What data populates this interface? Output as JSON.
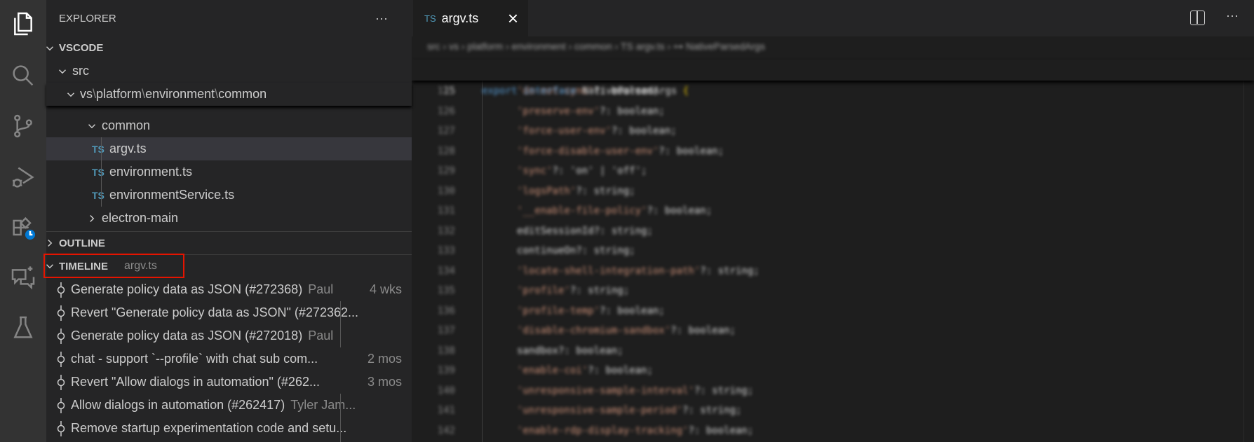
{
  "activity_bar": {
    "items": [
      {
        "name": "explorer",
        "icon": "files-icon"
      },
      {
        "name": "search",
        "icon": "search-icon"
      },
      {
        "name": "source-control",
        "icon": "source-control-icon"
      },
      {
        "name": "run-debug",
        "icon": "run-debug-icon"
      },
      {
        "name": "extensions",
        "icon": "extensions-icon",
        "badge": "clock-icon"
      },
      {
        "name": "chat",
        "icon": "chat-sparkle-icon"
      },
      {
        "name": "testing",
        "icon": "beaker-icon"
      }
    ]
  },
  "sidebar": {
    "title": "EXPLORER",
    "more": "···",
    "root": "VSCODE",
    "tree": {
      "src": "src",
      "sticky_path": [
        "vs",
        "platform",
        "environment",
        "common"
      ],
      "sep": "\\",
      "ghost": "environment",
      "items": [
        {
          "label": "common",
          "type": "folder",
          "expanded": true
        },
        {
          "label": "argv.ts",
          "type": "ts",
          "selected": true
        },
        {
          "label": "environment.ts",
          "type": "ts"
        },
        {
          "label": "environmentService.ts",
          "type": "ts"
        },
        {
          "label": "electron-main",
          "type": "folder",
          "expanded": false
        }
      ],
      "ts_badge": "TS"
    },
    "outline": "OUTLINE",
    "timeline": {
      "title": "TIMELINE",
      "file": "argv.ts",
      "highlight_color": "#e51400",
      "items": [
        {
          "label": "Generate policy data as JSON (#272368)",
          "author": "Paul",
          "time": "4 wks"
        },
        {
          "label": "Revert \"Generate policy data as JSON\" (#272362...",
          "author": "",
          "time": ""
        },
        {
          "label": "Generate policy data as JSON (#272018)",
          "author": "Paul",
          "time": ""
        },
        {
          "label": "chat - support `--profile` with chat sub com...",
          "author": "",
          "time": "2 mos"
        },
        {
          "label": "Revert \"Allow dialogs in automation\" (#262...",
          "author": "",
          "time": "3 mos"
        },
        {
          "label": "Allow dialogs in automation (#262417)",
          "author": "Tyler Jam...",
          "time": ""
        },
        {
          "label": "Remove startup experimentation code and setu...",
          "author": "",
          "time": ""
        }
      ]
    }
  },
  "editor": {
    "tab": {
      "badge": "TS",
      "label": "argv.ts",
      "close": "×"
    },
    "breadcrumb": "src › vs › platform › environment › common › TS argv.ts › ⊶ NativeParsedArgs",
    "sticky": {
      "line": "15",
      "code": "export interface NativeParsedArgs {"
    },
    "lines": [
      {
        "n": "125",
        "key": "'do-not-sync'",
        "rest": "?: boolean;"
      },
      {
        "n": "126",
        "key": "'preserve-env'",
        "rest": "?: boolean;"
      },
      {
        "n": "127",
        "key": "'force-user-env'",
        "rest": "?: boolean;"
      },
      {
        "n": "128",
        "key": "'force-disable-user-env'",
        "rest": "?: boolean;"
      },
      {
        "n": "129",
        "key": "'sync'",
        "rest": "?: 'on' | 'off';"
      },
      {
        "n": "130",
        "key": "'logsPath'",
        "rest": "?: string;"
      },
      {
        "n": "131",
        "key": "'__enable-file-policy'",
        "rest": "?: boolean;"
      },
      {
        "n": "132",
        "key": "",
        "rest": "editSessionId?: string;"
      },
      {
        "n": "133",
        "key": "",
        "rest": "continueOn?: string;"
      },
      {
        "n": "134",
        "key": "'locate-shell-integration-path'",
        "rest": "?: string;"
      },
      {
        "n": "135",
        "key": "'profile'",
        "rest": "?: string;"
      },
      {
        "n": "136",
        "key": "'profile-temp'",
        "rest": "?: boolean;"
      },
      {
        "n": "137",
        "key": "'disable-chromium-sandbox'",
        "rest": "?: boolean;"
      },
      {
        "n": "138",
        "key": "",
        "rest": "sandbox?: boolean;"
      },
      {
        "n": "139",
        "key": "'enable-coi'",
        "rest": "?: boolean;"
      },
      {
        "n": "140",
        "key": "'unresponsive-sample-interval'",
        "rest": "?: string;"
      },
      {
        "n": "141",
        "key": "'unresponsive-sample-period'",
        "rest": "?: string;"
      },
      {
        "n": "142",
        "key": "'enable-rdp-display-tracking'",
        "rest": "?: boolean;"
      }
    ]
  },
  "actions": {
    "split": "split-editor-icon",
    "more": "···"
  }
}
